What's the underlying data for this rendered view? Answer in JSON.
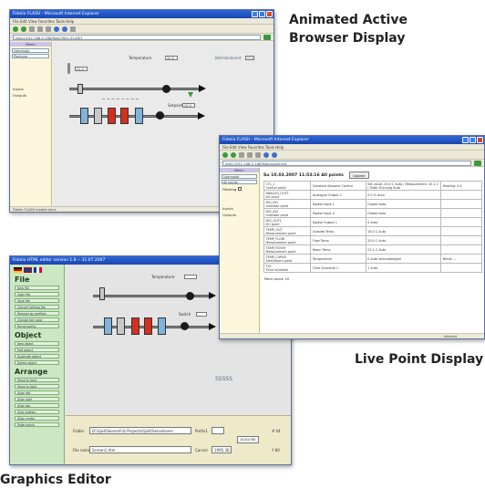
{
  "captions": {
    "animated_line1": "Animated Active",
    "animated_line2": "Browser Display",
    "live_point": "Live Point Display",
    "graphics_editor": "Graphics Editor"
  },
  "window_browser": {
    "title": "Fidelio FLASH - Microsoft Internet Explorer",
    "menu": "File   Edit   View   Favorites   Tools   Help",
    "address": "http://192.168.0.188/flash?file=FLASH",
    "status": "Fidelio FLASH loaded done",
    "sidebar": {
      "header": "Menu",
      "select1": "Usermode",
      "select2": "Plantype",
      "links": [
        "Inputs",
        "Outputs"
      ]
    },
    "diagram": {
      "temperature_label": "Temperature",
      "temperature_value": "20.0",
      "setpoint_label": "Setpoint",
      "setpoint_value": "20.0",
      "mode_label": "Betriebsbereit",
      "value_box": "21.0"
    }
  },
  "window_live": {
    "title": "Fidelio FLASH - Microsoft Internet Explorer",
    "menu": "File   Edit   View   Favorites   Tools   Help",
    "address": "http://192.168.0.188/flash/point/list",
    "status": "Internet",
    "heading": "Su 10.03.2007 11:53:16   All points",
    "update_button": "Update",
    "sidebar": {
      "header": "Menu",
      "select1": "Usermode",
      "select2": "All points",
      "filter_label": "Filtering",
      "links": [
        "Inputs",
        "Outputs"
      ]
    },
    "rows": [
      {
        "name": "CTL_1",
        "type": "Control point",
        "desc": "Constant Setpoint Control",
        "value": "Set value: 20.0 C Auto / Measurement: 20.1 C / Static Running Auto",
        "extra": "Heating: 0.0"
      },
      {
        "name": "ANALOG_OUT1",
        "type": "AO point",
        "desc": "Analogue Output 1",
        "value": "0.0 % Auto",
        "extra": ""
      },
      {
        "name": "DIG_IN1",
        "type": "Indicator point",
        "desc": "Digital Input 1",
        "value": "Closed Auto",
        "extra": ""
      },
      {
        "name": "DIG_IN2",
        "type": "Indicator point",
        "desc": "Digital Input 0",
        "value": "Closed Auto",
        "extra": ""
      },
      {
        "name": "DIG_OUT1",
        "type": "DO point",
        "desc": "Digital Output 1",
        "value": "0 Auto",
        "extra": ""
      },
      {
        "name": "TEMP_OUT",
        "type": "Measurement point",
        "desc": "Outside Temp",
        "value": "18.0 C Auto",
        "extra": ""
      },
      {
        "name": "TEMP_FLOW",
        "type": "Measurement point",
        "desc": "Flow Temp",
        "value": "20.0 C Auto",
        "extra": ""
      },
      {
        "name": "TEMP_ROOM",
        "type": "Measurement point",
        "desc": "Room Temp",
        "value": "22.2 C Auto",
        "extra": ""
      },
      {
        "name": "TEMP_CURVE",
        "type": "Alert/Alarm point",
        "desc": "Temperature",
        "value": "0 Auto acknowledged",
        "extra": "Bimat ---"
      },
      {
        "name": "TS1",
        "type": "Time schedule",
        "desc": "Time Schedule 1",
        "value": "1 Auto",
        "extra": ""
      }
    ],
    "footer": "Point count: 10"
  },
  "window_editor": {
    "title": "Fidelio HTML editor version 1.8  --  31.07.2007",
    "flags": "DE  GB  FR",
    "sections": [
      {
        "title": "File",
        "buttons": [
          "New file",
          "Open file",
          "Save file",
          "Convert bitmap file",
          "Rename by prefixes",
          "Change key color",
          "Recall points"
        ]
      },
      {
        "title": "Object",
        "buttons": [
          "New object",
          "Edit object",
          "Duplicate object",
          "Delete object"
        ]
      },
      {
        "title": "Arrange",
        "buttons": [
          "Move to front",
          "Move to back",
          "Align left",
          "Align right",
          "Align top",
          "Align bottom",
          "Align center",
          "Make points"
        ]
      }
    ],
    "diagram": {
      "temperature_label": "Temperature",
      "setpoint_label": "Switch",
      "brand": "SSSSS"
    },
    "bottom": {
      "folder_label": "Folder",
      "folder_value": "D:\\Gjeit\\Sense\\Fcb Projects\\Gjeit\\Senseleven",
      "filename_label": "File name",
      "filename_value": "Screen1.htm",
      "prefix_label": "Prefix1",
      "cancel_label": "Cancel",
      "cancel_value": "1995.38",
      "size_label": "1024x768",
      "pos1": "# 04",
      "pos2": "Y 80"
    }
  },
  "colors": {
    "titlebar": "#1b47b0",
    "editor_panel": "#cbe7c4",
    "sidebar": "#fbf6dc",
    "coil_red": "#d4301e",
    "coil_blue": "#7fb3dc"
  }
}
